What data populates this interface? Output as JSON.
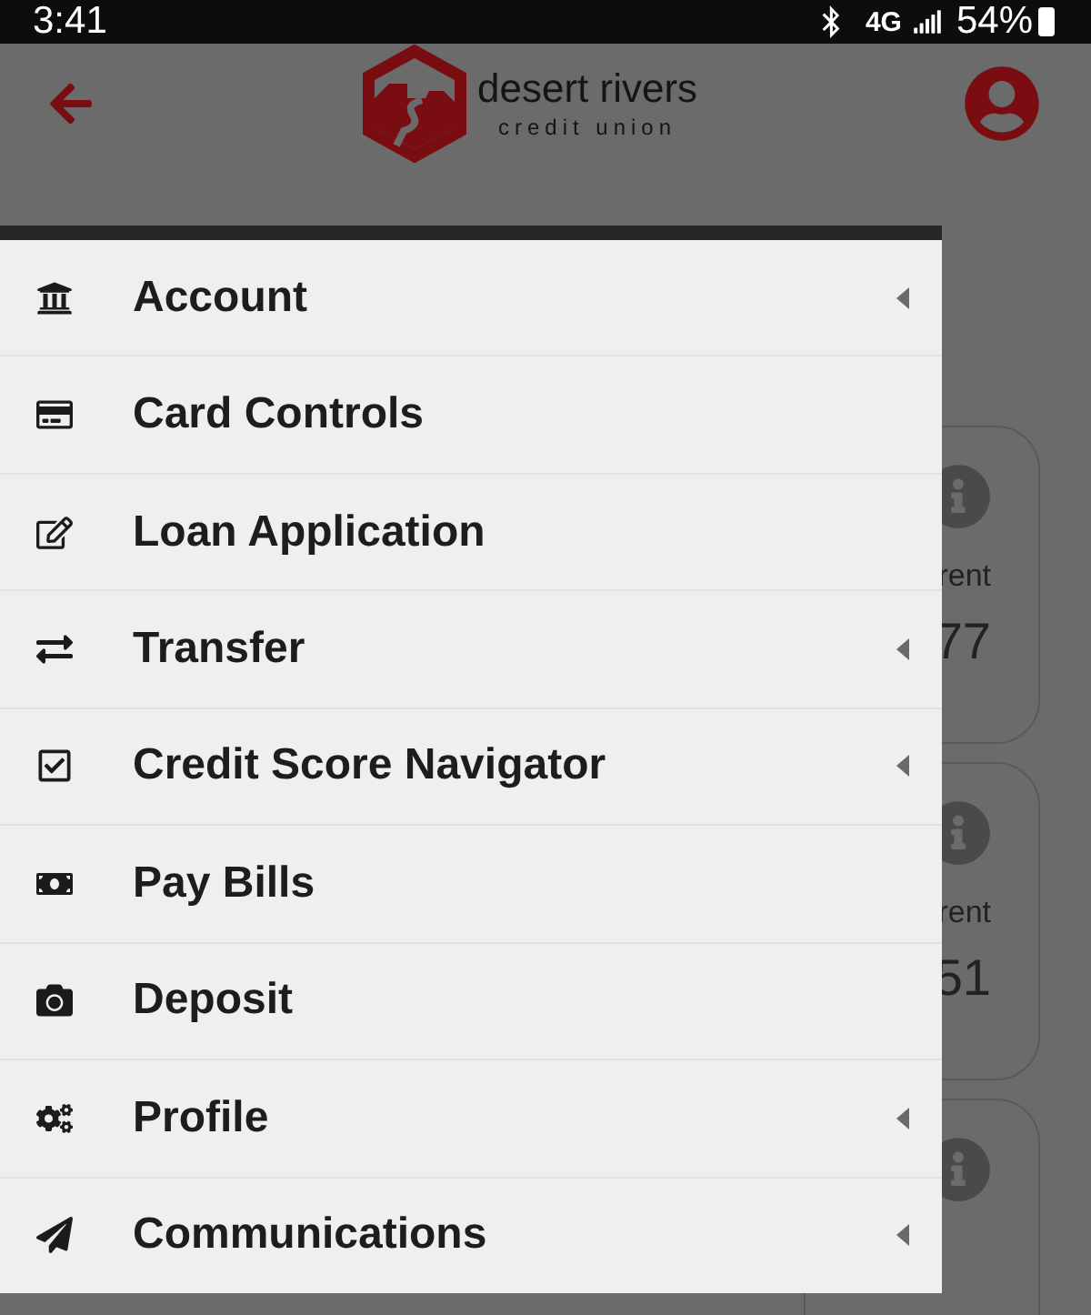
{
  "status_bar": {
    "time": "3:41",
    "network": "4G",
    "battery": "54%"
  },
  "header": {
    "brand": "desert rivers",
    "tagline": "credit union"
  },
  "background_cards": [
    {
      "kind": "info",
      "label": "rent",
      "value": "77"
    },
    {
      "kind": "info",
      "label": "rent",
      "value": "51"
    },
    {
      "kind": "info"
    }
  ],
  "menu": [
    {
      "kind": "bank",
      "label": "Account",
      "expandable": true
    },
    {
      "kind": "card",
      "label": "Card Controls",
      "expandable": false
    },
    {
      "kind": "edit",
      "label": "Loan Application",
      "expandable": false
    },
    {
      "kind": "transfer",
      "label": "Transfer",
      "expandable": true
    },
    {
      "kind": "check",
      "label": "Credit Score Navigator",
      "expandable": true
    },
    {
      "kind": "bill",
      "label": "Pay Bills",
      "expandable": false
    },
    {
      "kind": "camera",
      "label": "Deposit",
      "expandable": false
    },
    {
      "kind": "gears",
      "label": "Profile",
      "expandable": true
    },
    {
      "kind": "plane",
      "label": "Communications",
      "expandable": true
    }
  ]
}
